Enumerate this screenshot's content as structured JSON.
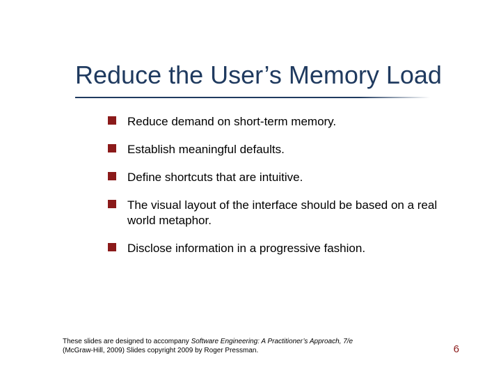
{
  "title": "Reduce the User’s Memory Load",
  "bullets": [
    "Reduce demand on short-term memory.",
    "Establish meaningful defaults.",
    "Define shortcuts that are intuitive.",
    "The visual layout of the interface should be based on a real world metaphor.",
    "Disclose information in a progressive fashion."
  ],
  "footer_line1_a": "These slides are designed to accompany ",
  "footer_line1_b": "Software Engineering: A Practitioner’s Approach, 7/e",
  "footer_line2": "(McGraw-Hill, 2009) Slides copyright 2009 by Roger Pressman.",
  "page_number": "6"
}
